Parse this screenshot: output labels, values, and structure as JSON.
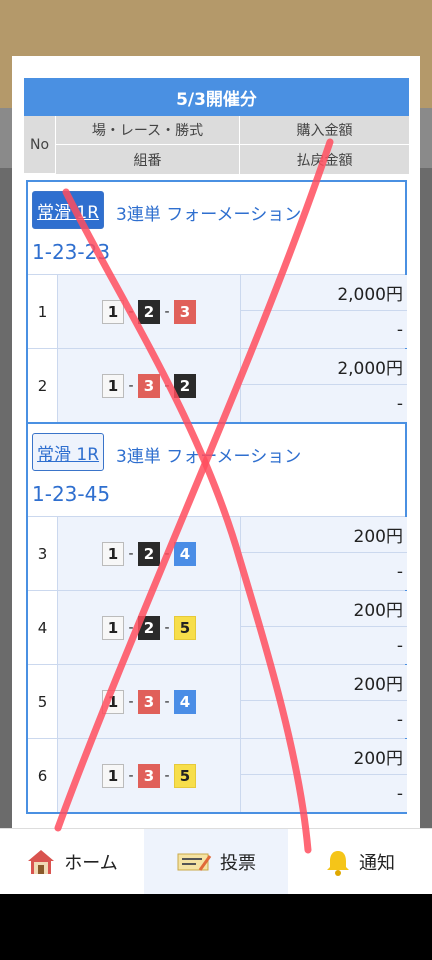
{
  "modal": {
    "title": "5/3開催分",
    "headers": {
      "no": "No",
      "venue_race_type": "場・レース・勝式",
      "purchase_amount": "購入金額",
      "combination": "組番",
      "payout": "払戻金額"
    },
    "groups": [
      {
        "race": "常滑 1R",
        "bet_type": "3連単 フォーメーション",
        "combo": "1-23-23",
        "rows": [
          {
            "no": "1",
            "boats": [
              "1",
              "2",
              "3"
            ],
            "amount": "2,000円",
            "payout": "-"
          },
          {
            "no": "2",
            "boats": [
              "1",
              "3",
              "2"
            ],
            "amount": "2,000円",
            "payout": "-"
          }
        ]
      },
      {
        "race": "常滑 1R",
        "bet_type": "3連単 フォーメーション",
        "combo": "1-23-45",
        "rows": [
          {
            "no": "3",
            "boats": [
              "1",
              "2",
              "4"
            ],
            "amount": "200円",
            "payout": "-"
          },
          {
            "no": "4",
            "boats": [
              "1",
              "2",
              "5"
            ],
            "amount": "200円",
            "payout": "-"
          },
          {
            "no": "5",
            "boats": [
              "1",
              "3",
              "4"
            ],
            "amount": "200円",
            "payout": "-"
          },
          {
            "no": "6",
            "boats": [
              "1",
              "3",
              "5"
            ],
            "amount": "200円",
            "payout": "-"
          }
        ]
      }
    ]
  },
  "nav": {
    "home": "ホーム",
    "vote": "投票",
    "notify": "通知"
  },
  "colors": {
    "accent": "#4a90e2",
    "boat1": "#f7f7f7",
    "boat2": "#2a2a2a",
    "boat3": "#e0605a",
    "boat4": "#4a8de6",
    "boat5": "#f7de4a",
    "annotation": "#ff4d5e"
  }
}
